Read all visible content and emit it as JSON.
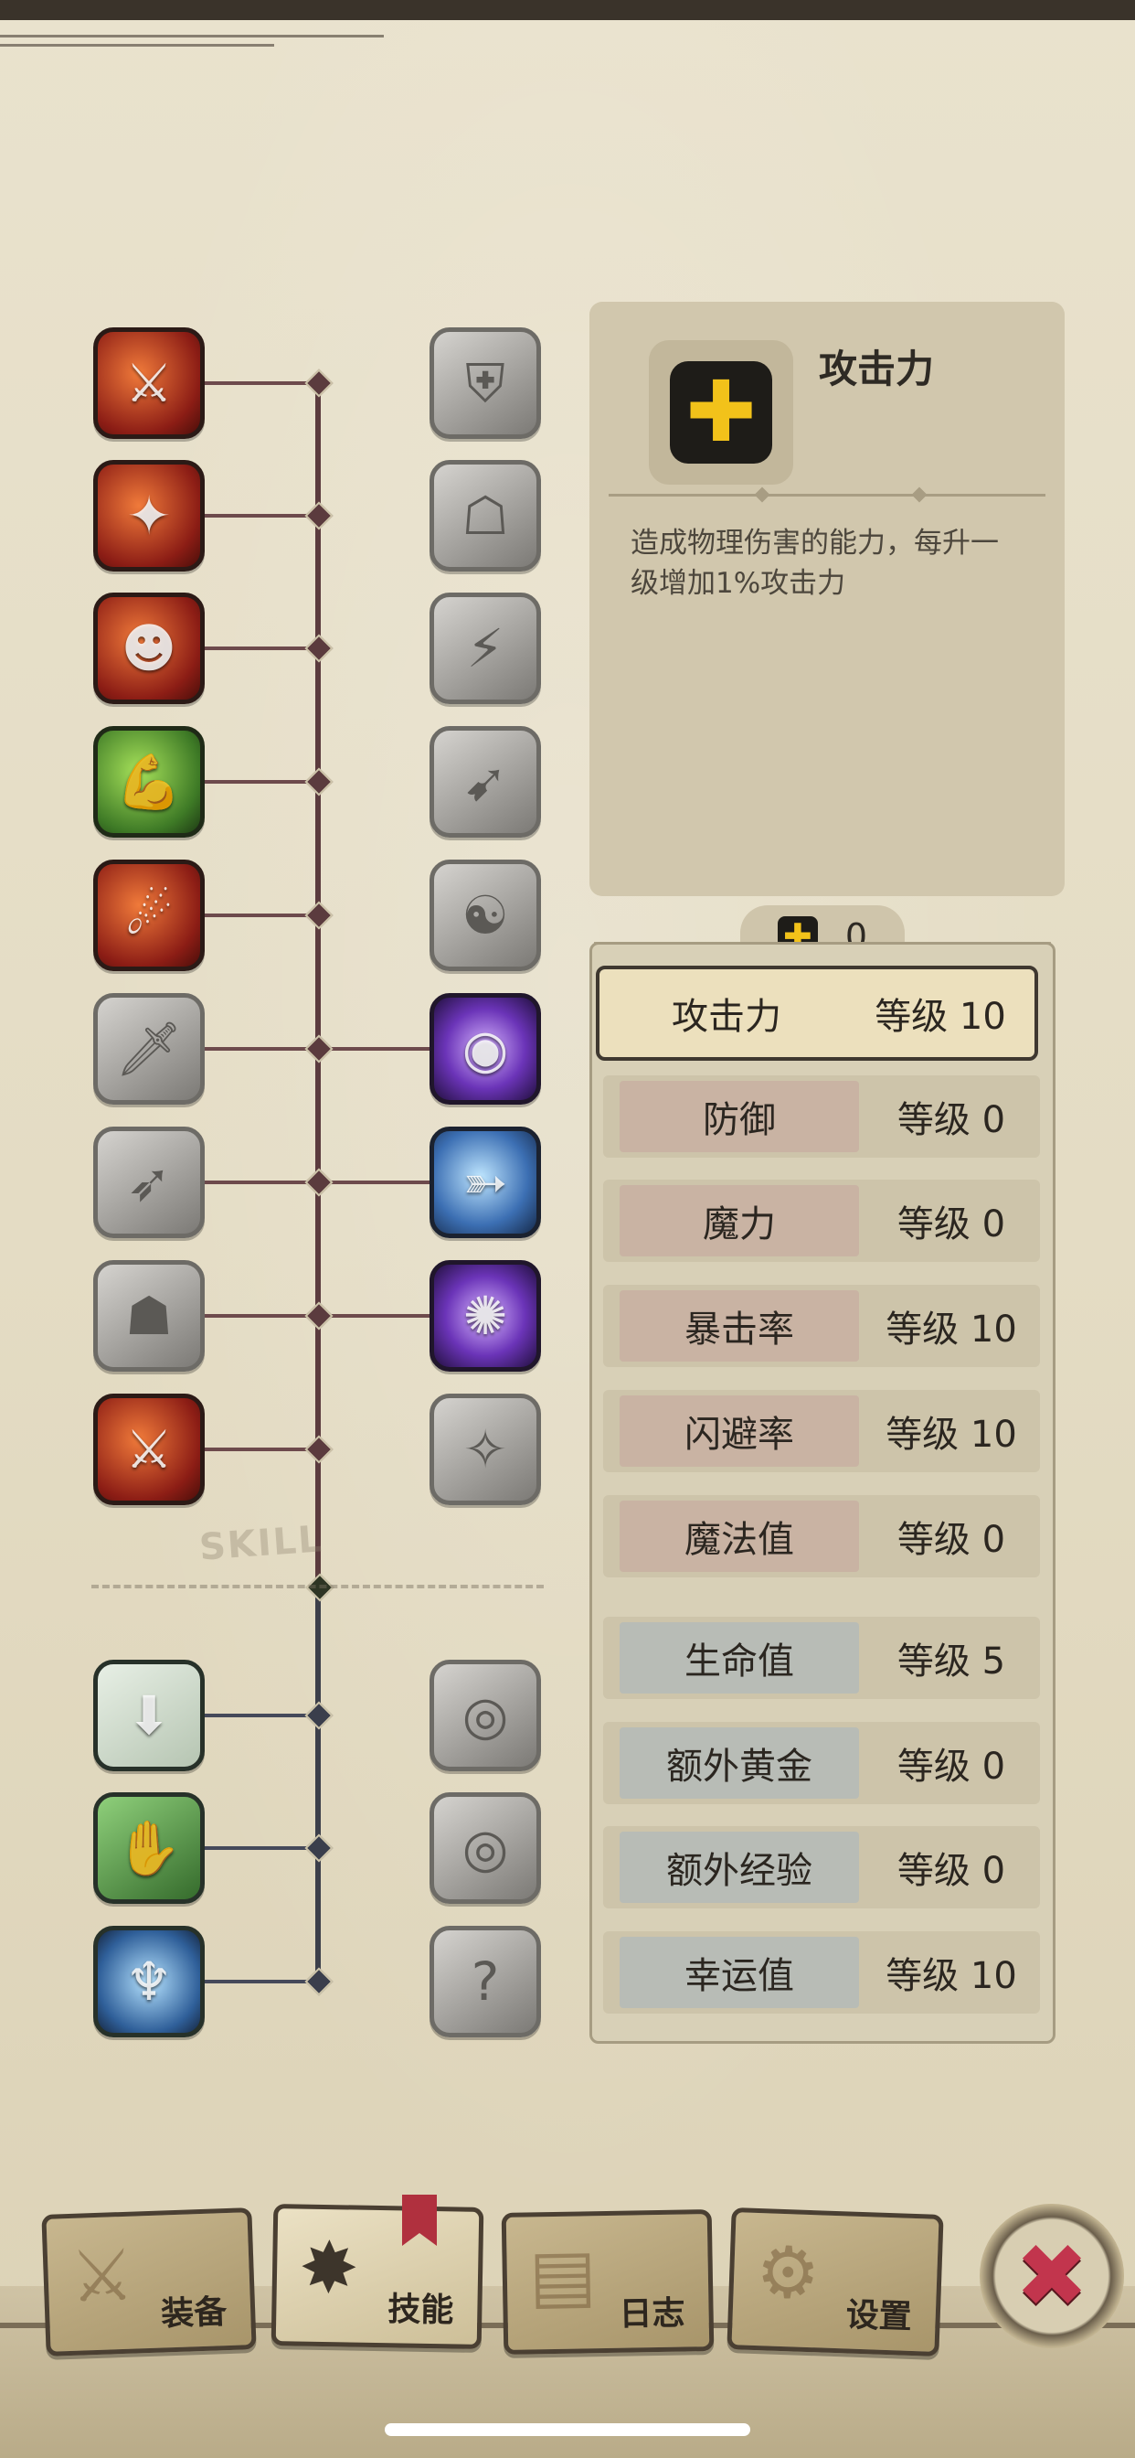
{
  "skill_tree": {
    "section_label": "SKILL",
    "left_column": [
      {
        "icon": "blade-slash-icon",
        "state": "active",
        "tone": "red"
      },
      {
        "icon": "fire-strike-icon",
        "state": "active",
        "tone": "red"
      },
      {
        "icon": "rage-scream-icon",
        "state": "active",
        "tone": "red"
      },
      {
        "icon": "muscle-arm-icon",
        "state": "active",
        "tone": "green"
      },
      {
        "icon": "spin-attack-icon",
        "state": "active",
        "tone": "red"
      },
      {
        "icon": "dagger-icon",
        "state": "locked",
        "tone": "grey"
      },
      {
        "icon": "dash-icon",
        "state": "locked",
        "tone": "grey"
      },
      {
        "icon": "rock-golem-icon",
        "state": "locked",
        "tone": "grey"
      },
      {
        "icon": "crossed-swords-icon",
        "state": "active",
        "tone": "red"
      }
    ],
    "right_column": [
      {
        "icon": "shield-icon",
        "state": "locked",
        "tone": "grey"
      },
      {
        "icon": "armor-guard-icon",
        "state": "locked",
        "tone": "grey"
      },
      {
        "icon": "lightning-icon",
        "state": "locked",
        "tone": "grey"
      },
      {
        "icon": "speed-run-icon",
        "state": "locked",
        "tone": "grey"
      },
      {
        "icon": "meditate-icon",
        "state": "locked",
        "tone": "grey"
      },
      {
        "icon": "magic-eye-icon",
        "state": "active",
        "tone": "purple"
      },
      {
        "icon": "whirl-blade-icon",
        "state": "active",
        "tone": "blue"
      },
      {
        "icon": "dark-orb-icon",
        "state": "active",
        "tone": "purple"
      },
      {
        "icon": "sparkle-spirit-icon",
        "state": "locked",
        "tone": "grey"
      }
    ],
    "lower_left": [
      {
        "icon": "treasure-drop-icon",
        "state": "active",
        "tone": "light"
      },
      {
        "icon": "gold-chest-icon",
        "state": "active",
        "tone": "green"
      },
      {
        "icon": "spirit-aura-icon",
        "state": "active",
        "tone": "blue"
      }
    ],
    "lower_right": [
      {
        "icon": "eye-chest-icon",
        "state": "locked",
        "tone": "grey"
      },
      {
        "icon": "eye-box-icon",
        "state": "locked",
        "tone": "grey"
      },
      {
        "icon": "mystery-figure-icon",
        "state": "locked",
        "tone": "grey"
      }
    ]
  },
  "info": {
    "title": "攻击力",
    "description": "造成物理伤害的能力，每升一级增加1%攻击力",
    "icon": "plus-icon"
  },
  "points": {
    "value": "0",
    "icon": "plus-icon"
  },
  "stats": [
    {
      "name": "攻击力",
      "level": "等级 10",
      "selected": true,
      "group": "warm"
    },
    {
      "name": "防御",
      "level": "等级 0",
      "selected": false,
      "group": "warm"
    },
    {
      "name": "魔力",
      "level": "等级 0",
      "selected": false,
      "group": "warm"
    },
    {
      "name": "暴击率",
      "level": "等级 10",
      "selected": false,
      "group": "warm"
    },
    {
      "name": "闪避率",
      "level": "等级 10",
      "selected": false,
      "group": "warm"
    },
    {
      "name": "魔法值",
      "level": "等级 0",
      "selected": false,
      "group": "warm"
    },
    {
      "name": "生命值",
      "level": "等级 5",
      "selected": false,
      "group": "cool"
    },
    {
      "name": "额外黄金",
      "level": "等级 0",
      "selected": false,
      "group": "cool"
    },
    {
      "name": "额外经验",
      "level": "等级 0",
      "selected": false,
      "group": "cool"
    },
    {
      "name": "幸运值",
      "level": "等级 10",
      "selected": false,
      "group": "cool"
    }
  ],
  "nav": {
    "equipment": "装备",
    "skills": "技能",
    "journal": "日志",
    "settings": "设置",
    "active": "skills"
  },
  "colors": {
    "accent_gold": "#f2c21a",
    "close_red": "#c2354d",
    "paper": "#e7dfc9"
  }
}
